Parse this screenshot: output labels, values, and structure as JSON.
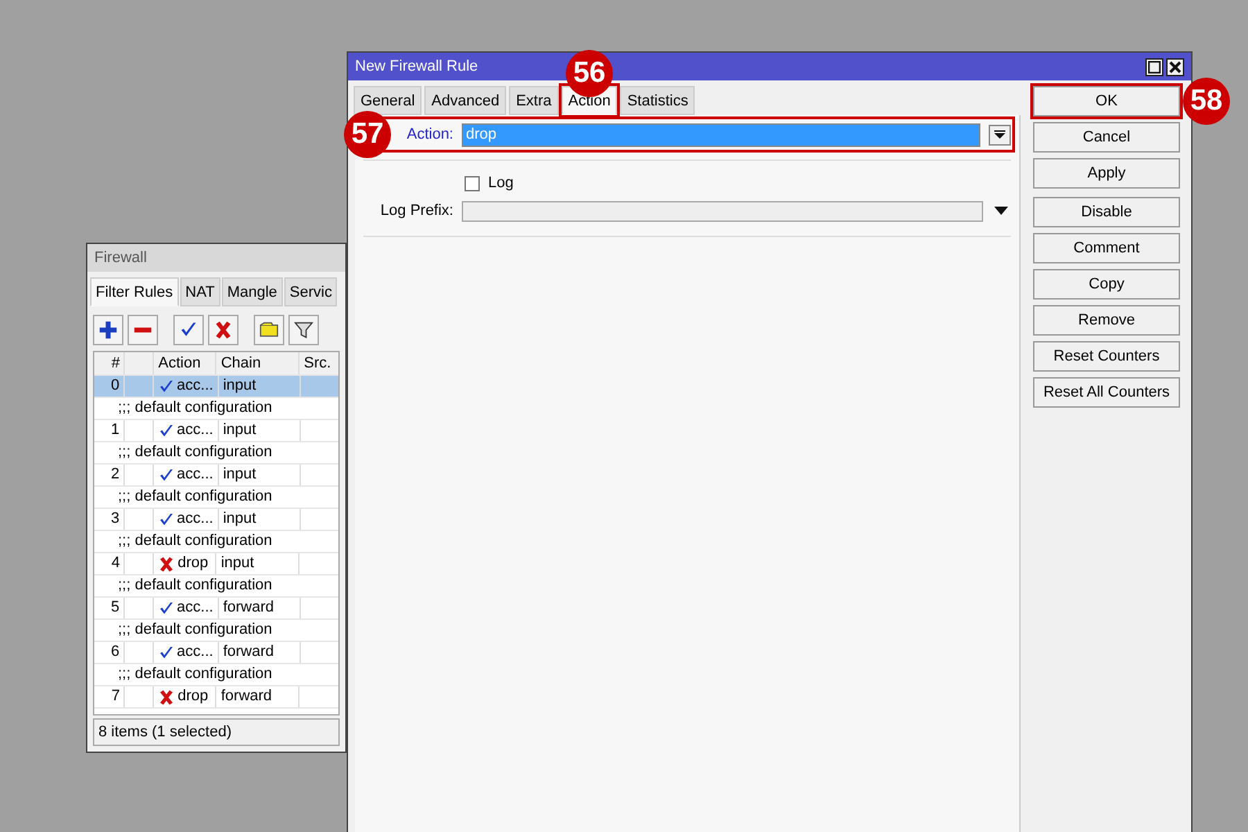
{
  "firewall": {
    "title": "Firewall",
    "tabs": [
      {
        "label": "Filter Rules",
        "selected": true
      },
      {
        "label": "NAT",
        "selected": false
      },
      {
        "label": "Mangle",
        "selected": false
      },
      {
        "label": "Servic",
        "selected": false
      }
    ],
    "toolbar": [
      {
        "kind": "add"
      },
      {
        "kind": "remove"
      },
      {
        "kind": "enable"
      },
      {
        "kind": "disable"
      },
      {
        "kind": "comment"
      },
      {
        "kind": "filter"
      }
    ],
    "table": {
      "columns": [
        "#",
        "Action",
        "Chain",
        "Src."
      ],
      "rows": [
        {
          "number": "0",
          "action": "acc...",
          "kind": "accept",
          "chain": "input",
          "selected": true
        },
        {
          "comment": ";;; default configuration",
          "number": "1",
          "action": "acc...",
          "kind": "accept",
          "chain": "input",
          "selected": false
        },
        {
          "comment": ";;; default configuration",
          "number": "2",
          "action": "acc...",
          "kind": "accept",
          "chain": "input",
          "selected": false
        },
        {
          "comment": ";;; default configuration",
          "number": "3",
          "action": "acc...",
          "kind": "accept",
          "chain": "input",
          "selected": false
        },
        {
          "comment": ";;; default configuration",
          "number": "4",
          "action": "drop",
          "kind": "drop",
          "chain": "input",
          "selected": false
        },
        {
          "comment": ";;; default configuration",
          "number": "5",
          "action": "acc...",
          "kind": "accept",
          "chain": "forward",
          "selected": false
        },
        {
          "comment": ";;; default configuration",
          "number": "6",
          "action": "acc...",
          "kind": "accept",
          "chain": "forward",
          "selected": false
        },
        {
          "comment": ";;; default configuration",
          "number": "7",
          "action": "drop",
          "kind": "drop",
          "chain": "forward",
          "selected": false
        }
      ]
    },
    "status_bar": "8 items (1 selected)"
  },
  "dialog": {
    "title": "New Firewall Rule",
    "tabs": [
      {
        "label": "General",
        "selected": false
      },
      {
        "label": "Advanced",
        "selected": false
      },
      {
        "label": "Extra",
        "selected": false
      },
      {
        "label": "Action",
        "selected": true,
        "callout": "56"
      }
    ],
    "extra_tabs": [
      {
        "label": "Statistics",
        "selected": false
      }
    ],
    "action_field": {
      "label": "Action:",
      "value": "drop",
      "callout": "57"
    },
    "log": {
      "label": "Log",
      "checked": false
    },
    "log_prefix": {
      "label": "Log Prefix:"
    },
    "button_groups": [
      [
        {
          "label": "OK",
          "callout": "58"
        },
        {
          "label": "Cancel"
        },
        {
          "label": "Apply"
        }
      ],
      [
        {
          "label": "Disable"
        },
        {
          "label": "Comment"
        },
        {
          "label": "Copy"
        },
        {
          "label": "Remove"
        },
        {
          "label": "Reset Counters"
        },
        {
          "label": "Reset All Counters"
        }
      ]
    ]
  }
}
